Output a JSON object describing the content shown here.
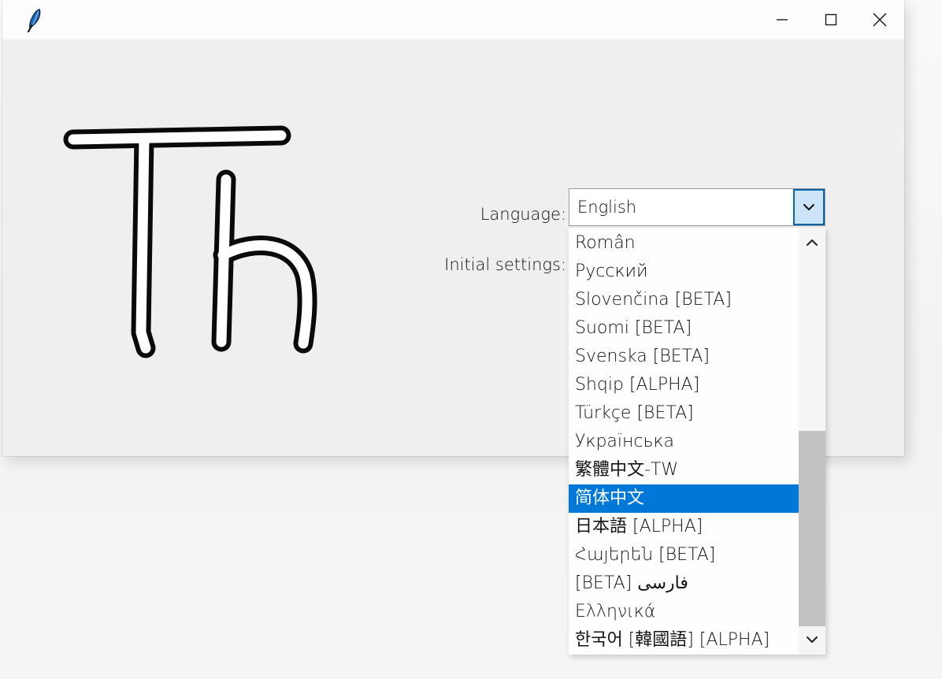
{
  "window": {
    "title": "",
    "app_icon": "feather-quill-icon",
    "logo_text": "Th",
    "controls": {
      "minimize_label": "—",
      "maximize_label": "□",
      "close_label": "✕"
    }
  },
  "form": {
    "language_label": "Language:",
    "initial_settings_label": "Initial settings:"
  },
  "language_combo": {
    "value": "English",
    "arrow_icon": "chevron-down-icon",
    "options": [
      {
        "label": "Român",
        "selected": false,
        "rtl": false
      },
      {
        "label": "Русский",
        "selected": false,
        "rtl": false
      },
      {
        "label": "Slovenčina [BETA]",
        "selected": false,
        "rtl": false
      },
      {
        "label": "Suomi [BETA]",
        "selected": false,
        "rtl": false
      },
      {
        "label": "Svenska [BETA]",
        "selected": false,
        "rtl": false
      },
      {
        "label": "Shqip [ALPHA]",
        "selected": false,
        "rtl": false
      },
      {
        "label": "Türkçe [BETA]",
        "selected": false,
        "rtl": false
      },
      {
        "label": "Українська",
        "selected": false,
        "rtl": false
      },
      {
        "label": "繁體中文-TW",
        "selected": false,
        "rtl": false
      },
      {
        "label": "简体中文",
        "selected": true,
        "rtl": false
      },
      {
        "label": "日本語 [ALPHA]",
        "selected": false,
        "rtl": false
      },
      {
        "label": "Հայերեն [BETA]",
        "selected": false,
        "rtl": false
      },
      {
        "label": "فارسی [BETA]",
        "selected": false,
        "rtl": true
      },
      {
        "label": "Ελληνικά",
        "selected": false,
        "rtl": false
      },
      {
        "label": "한국어 [韓國語] [ALPHA]",
        "selected": false,
        "rtl": false
      }
    ],
    "scrollbar": {
      "up_icon": "chevron-up-icon",
      "down_icon": "chevron-down-icon"
    }
  },
  "colors": {
    "accent": "#0078d7",
    "combo_arrow_fill": "#cce4f7",
    "combo_arrow_border": "#0a64ad",
    "window_bg": "#efeff0",
    "titlebar_bg": "#fdfdfd",
    "scroll_thumb": "#c2c2c2"
  }
}
